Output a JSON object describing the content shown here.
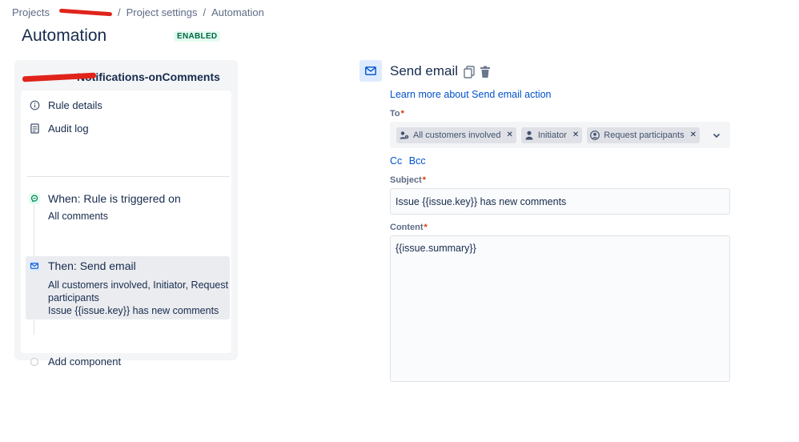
{
  "breadcrumb": {
    "items": [
      "Projects",
      "Project settings",
      "Automation"
    ],
    "separator": "/"
  },
  "header": {
    "title": "Automation",
    "status": "ENABLED"
  },
  "rule": {
    "name": "Notifications-onComments",
    "nav": [
      {
        "label": "Rule details",
        "icon": "info-icon"
      },
      {
        "label": "Audit log",
        "icon": "document-icon"
      }
    ],
    "trigger": {
      "title": "When: Rule is triggered on",
      "description": "All comments",
      "icon": "comment-icon"
    },
    "action": {
      "title": "Then: Send email",
      "description_recipients": "All customers involved, Initiator, Request participants",
      "description_subject": "Issue {{issue.key}} has new comments",
      "icon": "email-icon"
    },
    "add_component": "Add component"
  },
  "editor": {
    "title": "Send email",
    "learn_more": "Learn more about Send email action",
    "to": {
      "label": "To",
      "required_mark": "*",
      "recipients": [
        {
          "label": "All customers involved",
          "icon": "people-icon"
        },
        {
          "label": "Initiator",
          "icon": "person-icon"
        },
        {
          "label": "Request participants",
          "icon": "user-circle-icon"
        }
      ]
    },
    "cc_label": "Cc",
    "bcc_label": "Bcc",
    "subject": {
      "label": "Subject",
      "required_mark": "*",
      "value": "Issue {{issue.key}} has new comments"
    },
    "content": {
      "label": "Content",
      "required_mark": "*",
      "value": "{{issue.summary}}"
    }
  },
  "colors": {
    "link": "#0052cc",
    "text": "#172b4d",
    "enabled_badge_bg": "#e3fcef",
    "enabled_badge_text": "#006644",
    "required": "#de350b"
  }
}
